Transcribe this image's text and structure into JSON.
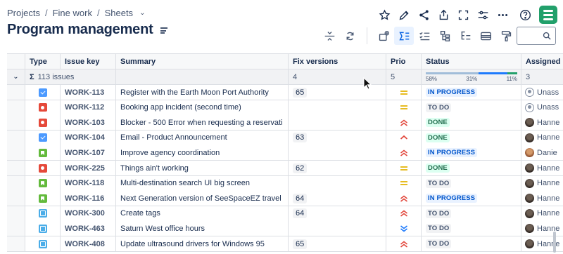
{
  "breadcrumbs": [
    "Projects",
    "Fine work",
    "Sheets"
  ],
  "page_title": "Program management",
  "search": {
    "placeholder": ""
  },
  "top_actions": [
    "star-icon",
    "edit-icon",
    "share-icon",
    "export-icon",
    "fullscreen-icon",
    "filter-settings-icon",
    "more-icon",
    "help-icon",
    "app-logo-icon"
  ],
  "toolbar_actions": [
    "collapse-rows-icon",
    "refresh-icon",
    "insert-field-icon",
    "sum-icon",
    "checklist-icon",
    "hierarchy-icon",
    "tree-icon",
    "card-icon",
    "format-painter-icon"
  ],
  "columns": [
    "Type",
    "Issue key",
    "Summary",
    "Fix versions",
    "Prio",
    "Status",
    "Assigned"
  ],
  "summary_row": {
    "sigma": "Σ",
    "label": "113 issues",
    "fix_count": "4",
    "prio_count": "5",
    "assigned_count": "3",
    "status_split": [
      {
        "pct": 58,
        "label": "58%",
        "color": "#a1bdd9"
      },
      {
        "pct": 31,
        "label": "31%",
        "color": "#1d7afc"
      },
      {
        "pct": 11,
        "label": "11%",
        "color": "#22a06b"
      }
    ]
  },
  "colors": {
    "todo_bg": "#f1f2f4",
    "todo_fg": "#44546f",
    "inprogress_bg": "#e9f2ff",
    "inprogress_fg": "#0055cc",
    "done_bg": "#dcfff1",
    "done_fg": "#216e4e",
    "prio_medium": "#e2b203",
    "prio_high": "#e2483d",
    "prio_low": "#1d7afc"
  },
  "rows": [
    {
      "type": "task",
      "key": "WORK-113",
      "summary": "Register with the Earth Moon Port Authority",
      "fix": "65",
      "prio": "medium",
      "status": "IN PROGRESS",
      "status_kind": "inprogress",
      "assignee": "Unass",
      "avatar": "unassigned"
    },
    {
      "type": "bug",
      "key": "WORK-112",
      "summary": "Booking app incident (second time)",
      "fix": "",
      "prio": "medium",
      "status": "TO DO",
      "status_kind": "todo",
      "assignee": "Unass",
      "avatar": "unassigned"
    },
    {
      "type": "bug",
      "key": "WORK-103",
      "summary": "Blocker - 500 Error when requesting a reservati",
      "fix": "",
      "prio": "highest",
      "status": "DONE",
      "status_kind": "done",
      "assignee": "Hanne",
      "avatar": "photo1"
    },
    {
      "type": "task",
      "key": "WORK-104",
      "summary": "Email - Product Announcement",
      "fix": "63",
      "prio": "high",
      "status": "DONE",
      "status_kind": "done",
      "assignee": "Hanne",
      "avatar": "photo1"
    },
    {
      "type": "story",
      "key": "WORK-107",
      "summary": "Improve agency coordination",
      "fix": "",
      "prio": "highest",
      "status": "IN PROGRESS",
      "status_kind": "inprogress",
      "assignee": "Danie",
      "avatar": "photo2"
    },
    {
      "type": "bug",
      "key": "WORK-225",
      "summary": "Things ain't working",
      "fix": "62",
      "prio": "medium",
      "status": "DONE",
      "status_kind": "done",
      "assignee": "Hanne",
      "avatar": "photo1"
    },
    {
      "type": "story",
      "key": "WORK-118",
      "summary": "Multi-destination search UI big screen",
      "fix": "",
      "prio": "medium",
      "status": "TO DO",
      "status_kind": "todo",
      "assignee": "Hanne",
      "avatar": "photo1"
    },
    {
      "type": "story",
      "key": "WORK-116",
      "summary": "Next Generation version of SeeSpaceEZ travel",
      "fix": "64",
      "prio": "highest",
      "status": "IN PROGRESS",
      "status_kind": "inprogress",
      "assignee": "Hanne",
      "avatar": "photo1"
    },
    {
      "type": "subtask",
      "key": "WORK-300",
      "summary": "Create tags",
      "fix": "64",
      "prio": "highest",
      "status": "TO DO",
      "status_kind": "todo",
      "assignee": "Hanne",
      "avatar": "photo1"
    },
    {
      "type": "subtask",
      "key": "WORK-463",
      "summary": "Saturn West office hours",
      "fix": "",
      "prio": "lowest",
      "status": "TO DO",
      "status_kind": "todo",
      "assignee": "Hanne",
      "avatar": "photo1"
    },
    {
      "type": "subtask",
      "key": "WORK-408",
      "summary": "Update ultrasound drivers for Windows 95",
      "fix": "65",
      "prio": "highest",
      "status": "TO DO",
      "status_kind": "todo",
      "assignee": "Hanne",
      "avatar": "photo1"
    }
  ]
}
